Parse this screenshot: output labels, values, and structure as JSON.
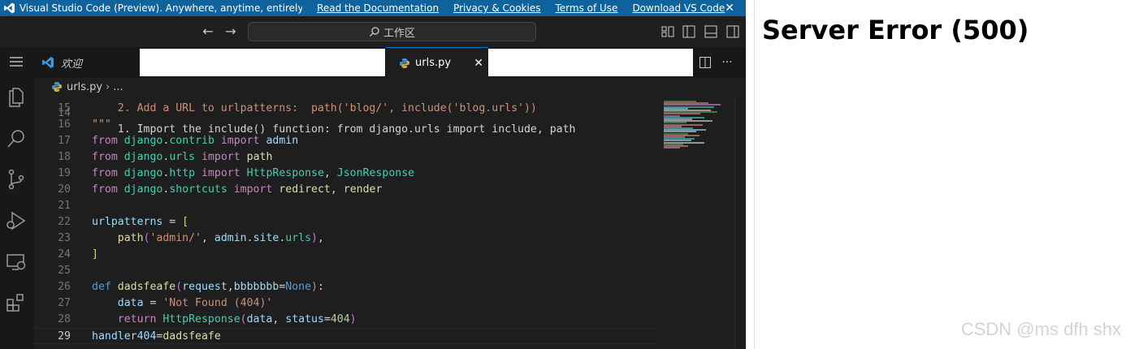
{
  "banner": {
    "message": "Visual Studio Code (Preview). Anywhere, anytime, entirely in yo...",
    "links": [
      "Read the Documentation",
      "Privacy & Cookies",
      "Terms of Use",
      "Download VS Code"
    ]
  },
  "titlebar": {
    "command_center": "工作区"
  },
  "tabs": {
    "welcome_label": "欢迎",
    "active_label": "urls.py"
  },
  "breadcrumb": {
    "file": "urls.py",
    "more": "..."
  },
  "editor": {
    "lines": [
      {
        "n": "15",
        "code": "    2. Add a URL to urlpatterns:  path('blog/', include('blog.urls'))"
      },
      {
        "n": "16",
        "code": "\"\"\""
      },
      {
        "n": "17",
        "code": "from django.contrib import admin"
      },
      {
        "n": "18",
        "code": "from django.urls import path"
      },
      {
        "n": "19",
        "code": "from django.http import HttpResponse, JsonResponse"
      },
      {
        "n": "20",
        "code": "from django.shortcuts import redirect, render"
      },
      {
        "n": "21",
        "code": ""
      },
      {
        "n": "22",
        "code": "urlpatterns = ["
      },
      {
        "n": "23",
        "code": "    path('admin/', admin.site.urls),"
      },
      {
        "n": "24",
        "code": "]"
      },
      {
        "n": "25",
        "code": ""
      },
      {
        "n": "26",
        "code": "def dadsfeafe(request,bbbbbbb=None):"
      },
      {
        "n": "27",
        "code": "    data = 'Not Found (404)'"
      },
      {
        "n": "28",
        "code": "    return HttpResponse(data, status=404)"
      },
      {
        "n": "29",
        "code": "handler404=dadsfeafe"
      }
    ],
    "current_line": "29"
  },
  "preview": {
    "heading": "Server Error (500)",
    "watermark": "CSDN @ms dfh shx"
  },
  "colors": {
    "banner_bg": "#0e639c",
    "editor_bg": "#1e1e1e",
    "keyword": "#c586c0",
    "string": "#ce9178",
    "type": "#4ec9b0"
  }
}
